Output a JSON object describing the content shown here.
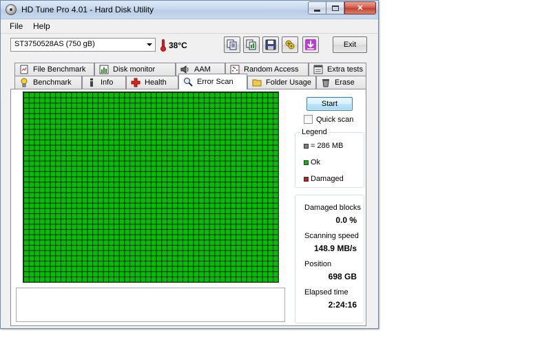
{
  "window": {
    "title": "HD Tune Pro 4.01 - Hard Disk Utility"
  },
  "menu": {
    "file": "File",
    "help": "Help"
  },
  "toolbar": {
    "drive": "ST3750528AS (750 gB)",
    "temperature": "38°C",
    "exit_label": "Exit",
    "buttons": [
      "copy-text-icon",
      "copy-image-icon",
      "save-icon",
      "options-icon",
      "download-icon"
    ]
  },
  "tabs": {
    "back_row": [
      {
        "label": "File Benchmark",
        "icon": "file-benchmark-icon"
      },
      {
        "label": "Disk monitor",
        "icon": "disk-monitor-icon"
      },
      {
        "label": "AAM",
        "icon": "speaker-icon"
      },
      {
        "label": "Random Access",
        "icon": "random-access-icon"
      },
      {
        "label": "Extra tests",
        "icon": "extra-tests-icon"
      }
    ],
    "front_row": [
      {
        "label": "Benchmark",
        "icon": "lightbulb-icon"
      },
      {
        "label": "Info",
        "icon": "info-icon"
      },
      {
        "label": "Health",
        "icon": "health-cross-icon"
      },
      {
        "label": "Error Scan",
        "icon": "magnifier-icon",
        "active": true
      },
      {
        "label": "Folder Usage",
        "icon": "folder-icon"
      },
      {
        "label": "Erase",
        "icon": "trash-icon"
      }
    ]
  },
  "scan": {
    "start_label": "Start",
    "quick_scan_label": "Quick scan",
    "quick_scan_checked": false,
    "grid_cols": 48,
    "grid_rows": 36,
    "block_status": "ok"
  },
  "legend": {
    "title": "Legend",
    "block_size": "= 286 MB",
    "ok": "Ok",
    "damaged": "Damaged",
    "colors": {
      "block": "#808080",
      "ok": "#00c000",
      "damaged": "#c02020"
    }
  },
  "stats": {
    "damaged_blocks_label": "Damaged blocks",
    "damaged_blocks_value": "0.0 %",
    "scanning_speed_label": "Scanning speed",
    "scanning_speed_value": "148.9 MB/s",
    "position_label": "Position",
    "position_value": "698 GB",
    "elapsed_label": "Elapsed time",
    "elapsed_value": "2:24:16"
  }
}
